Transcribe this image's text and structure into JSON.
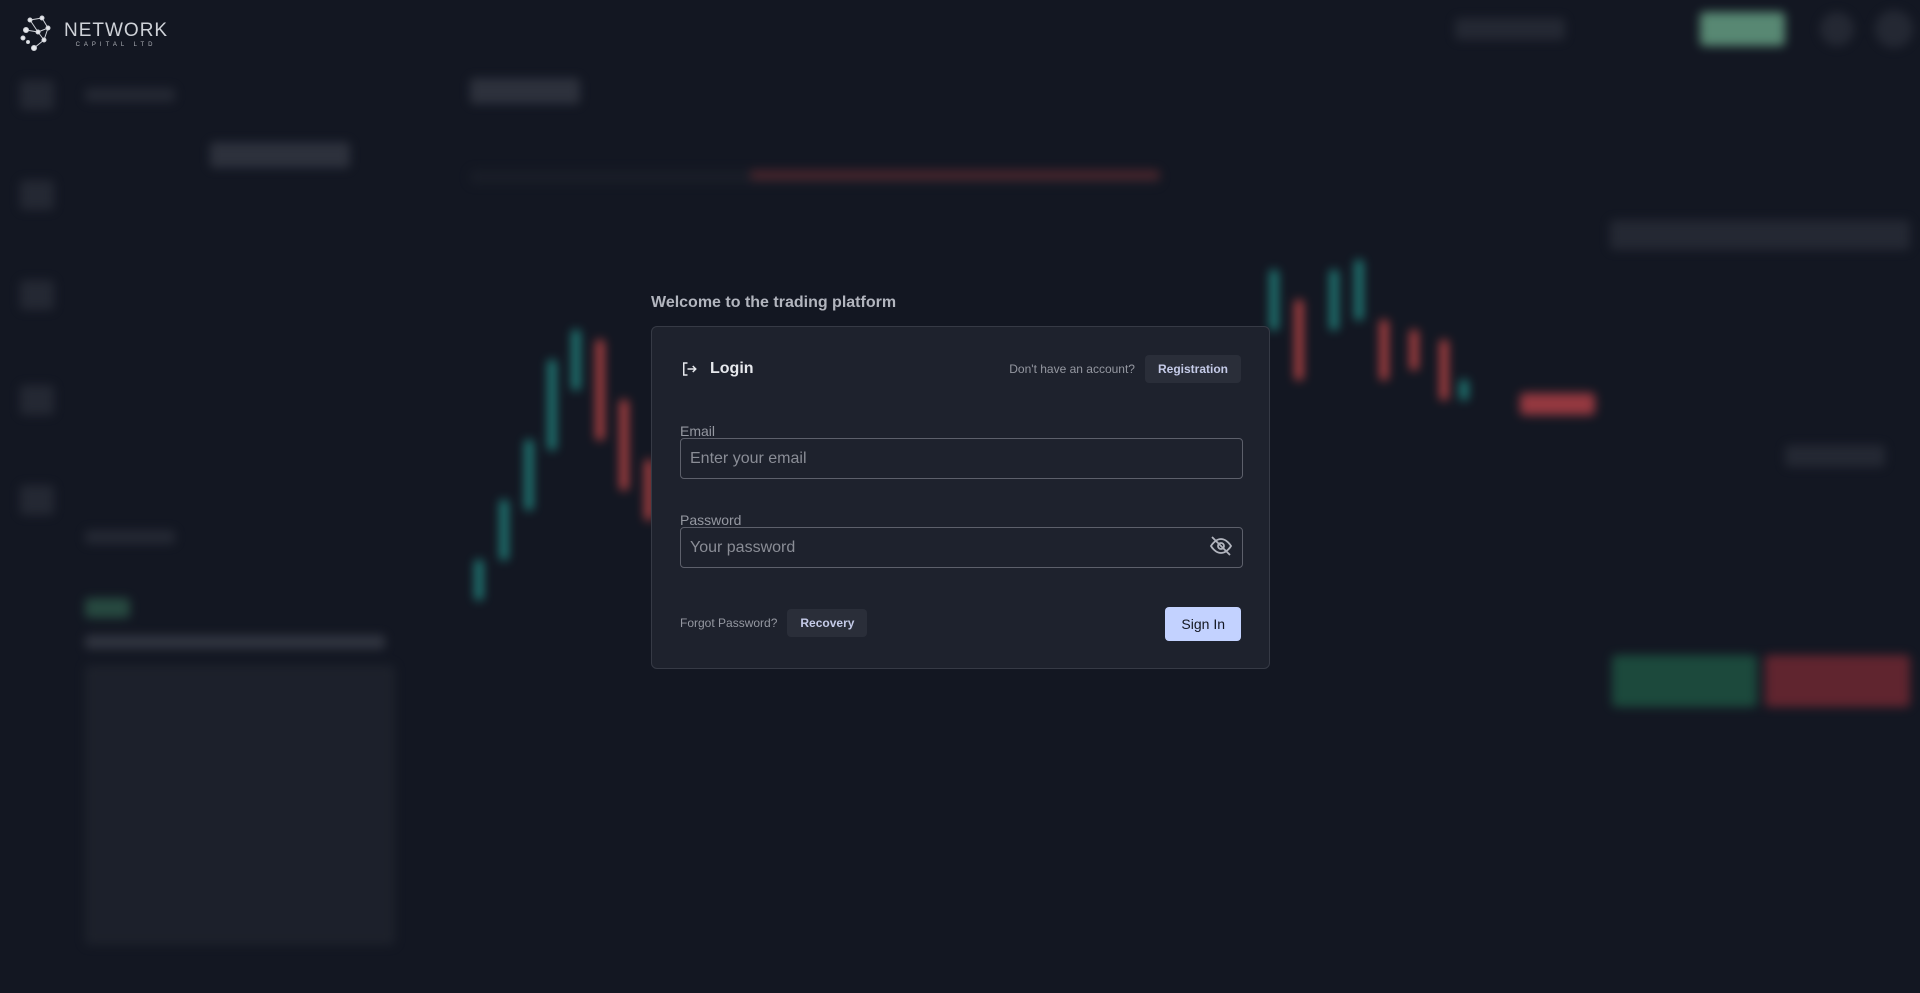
{
  "brand": {
    "name": "NETWORK",
    "tagline": "CAPITAL LTD"
  },
  "welcome": "Welcome to the trading platform",
  "login": {
    "icon": "login-arrow-icon",
    "title": "Login",
    "no_account": "Don't have an account?",
    "registration": "Registration",
    "email_label": "Email",
    "email_placeholder": "Enter your email",
    "password_label": "Password",
    "password_placeholder": "Your password",
    "toggle_visibility_icon": "eye-off-icon",
    "forgot": "Forgot Password?",
    "recovery": "Recovery",
    "sign_in": "Sign In"
  },
  "colors": {
    "background": "#131722",
    "modal": "#1e222d",
    "accent": "#c3d2ff",
    "up": "#26a69a",
    "down": "#ef5350"
  }
}
